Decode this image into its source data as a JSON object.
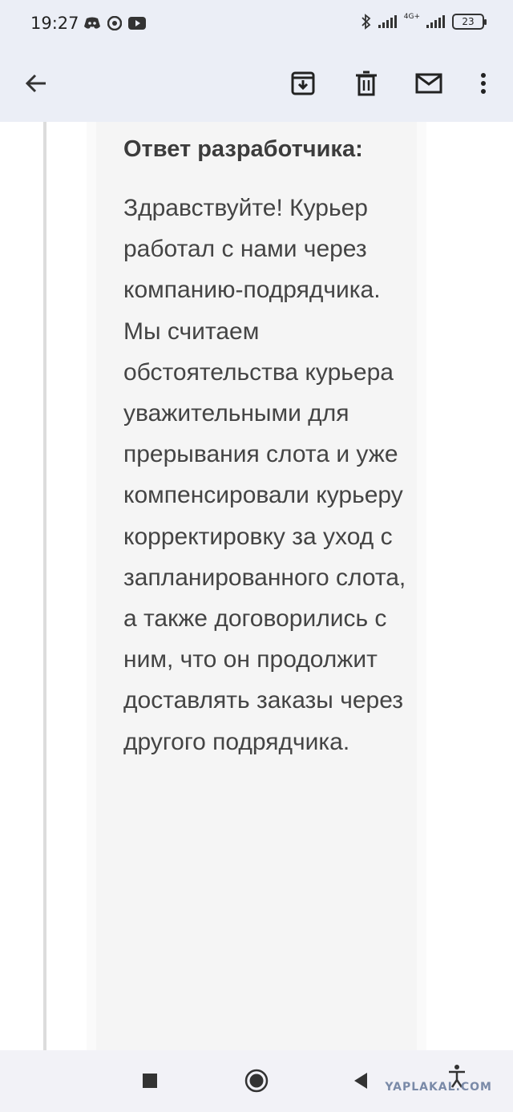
{
  "status": {
    "time": "19:27",
    "network": "4G+",
    "battery": "23"
  },
  "app_bar": {
    "icons": [
      "back-arrow-icon",
      "archive-icon",
      "delete-icon",
      "mail-icon",
      "more-vert-icon"
    ]
  },
  "reply": {
    "heading": "Ответ разработчика:",
    "body": "Здравствуйте! Курьер работал с нами через компанию-подрядчика. Мы считаем обстоятельства курьера уважительными для прерывания слота и уже компенсировали курьеру корректировку за уход с запланированного слота, а также договорились с ним, что он продолжит доставлять заказы через другого подрядчика."
  },
  "nav": {
    "icons": [
      "recents-square-icon",
      "home-circle-icon",
      "back-triangle-icon",
      "accessibility-icon"
    ]
  },
  "watermark": "YAPLAKAL.COM"
}
